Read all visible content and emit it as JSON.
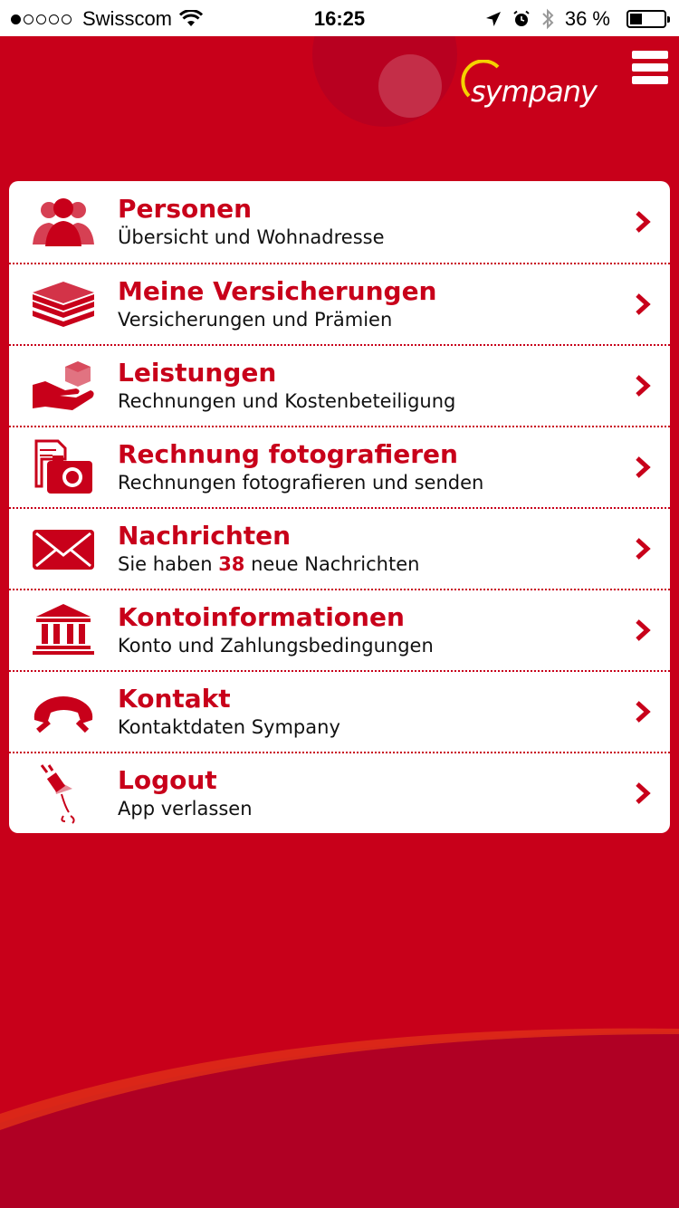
{
  "status_bar": {
    "carrier": "Swisscom",
    "time": "16:25",
    "battery_text": "36 %",
    "battery_fraction": 0.36
  },
  "header": {
    "logo_text": "sympany"
  },
  "colors": {
    "brand_red": "#c8001a",
    "white": "#ffffff",
    "logo_yellow": "#f5d200"
  },
  "menu": [
    {
      "title": "Personen",
      "subtitle": "Übersicht und Wohnadresse",
      "icon": "people-icon"
    },
    {
      "title": "Meine Versicherungen",
      "subtitle": "Versicherungen und Prämien",
      "icon": "stack-icon"
    },
    {
      "title": "Leistungen",
      "subtitle": "Rechnungen und Kostenbeteiligung",
      "icon": "hand-box-icon"
    },
    {
      "title": "Rechnung fotografieren",
      "subtitle": "Rechnungen fotografieren und senden",
      "icon": "camera-document-icon"
    },
    {
      "title": "Nachrichten",
      "subtitle_prefix": "Sie haben ",
      "count": "38",
      "subtitle_suffix": " neue Nachrichten",
      "icon": "envelope-icon"
    },
    {
      "title": "Kontoinformationen",
      "subtitle": "Konto und Zahlungsbedingungen",
      "icon": "bank-icon"
    },
    {
      "title": "Kontakt",
      "subtitle": "Kontaktdaten Sympany",
      "icon": "phone-icon"
    },
    {
      "title": "Logout",
      "subtitle": "App verlassen",
      "icon": "unplug-icon"
    }
  ]
}
